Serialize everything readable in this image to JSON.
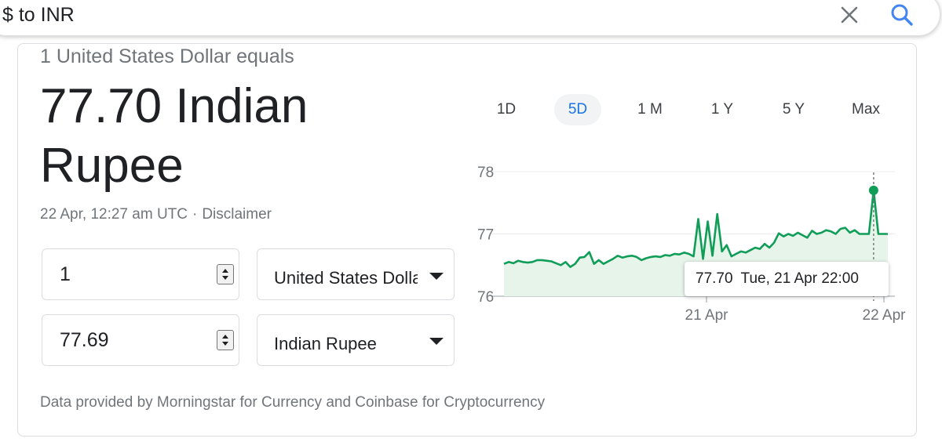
{
  "search": {
    "query": "$ to INR"
  },
  "converter": {
    "equals_text": "1 United States Dollar equals",
    "result_text": "77.70 Indian Rupee",
    "timestamp": "22 Apr, 12:27 am UTC",
    "separator": "·",
    "disclaimer": "Disclaimer",
    "from_amount": "1",
    "from_currency": "United States Dollar",
    "to_amount": "77.69",
    "to_currency": "Indian Rupee",
    "footer": "Data provided by Morningstar for Currency and Coinbase for Cryptocurrency"
  },
  "range_tabs": [
    "1D",
    "5D",
    "1 M",
    "1 Y",
    "5 Y",
    "Max"
  ],
  "active_range": "5D",
  "tooltip": {
    "value": "77.70",
    "datetime": "Tue, 21 Apr 22:00"
  },
  "colors": {
    "line": "#0f9d58",
    "fill": "#e6f4ea",
    "active_tab": "#1a73e8"
  },
  "icons": {
    "clear": "close-icon",
    "search": "search-icon",
    "spinner": "spinner-arrows-icon",
    "dropdown": "dropdown-arrow-icon"
  },
  "chart_data": {
    "type": "area",
    "title": "",
    "xlabel": "",
    "ylabel": "",
    "yticks": [
      76,
      77,
      78
    ],
    "ylim": [
      76,
      78
    ],
    "baseline": 76,
    "xtick_labels": [
      "21 Apr",
      "22 Apr"
    ],
    "grid": true,
    "values": [
      76.52,
      76.55,
      76.53,
      76.57,
      76.55,
      76.54,
      76.55,
      76.58,
      76.58,
      76.57,
      76.56,
      76.53,
      76.5,
      76.55,
      76.47,
      76.52,
      76.62,
      76.63,
      76.71,
      76.52,
      76.58,
      76.52,
      76.56,
      76.6,
      76.65,
      76.62,
      76.64,
      76.65,
      76.63,
      76.58,
      76.61,
      76.63,
      76.64,
      76.63,
      76.66,
      76.65,
      76.68,
      76.67,
      76.7,
      76.68,
      76.64,
      77.24,
      76.6,
      77.2,
      76.65,
      77.32,
      76.72,
      76.82,
      76.64,
      76.68,
      76.72,
      76.7,
      76.74,
      76.78,
      76.76,
      76.84,
      76.78,
      76.86,
      77.01,
      76.96,
      77.0,
      76.97,
      77.02,
      76.98,
      76.94,
      77.05,
      77.0,
      77.02,
      77.06,
      77.04,
      77.0,
      77.08,
      77.1,
      77.02,
      77.06,
      77.0,
      77.0,
      77.0,
      77.7,
      77.0,
      77.0,
      77.0
    ],
    "highlight": {
      "value": 77.7,
      "label": "77.70 Tue, 21 Apr 22:00"
    }
  }
}
